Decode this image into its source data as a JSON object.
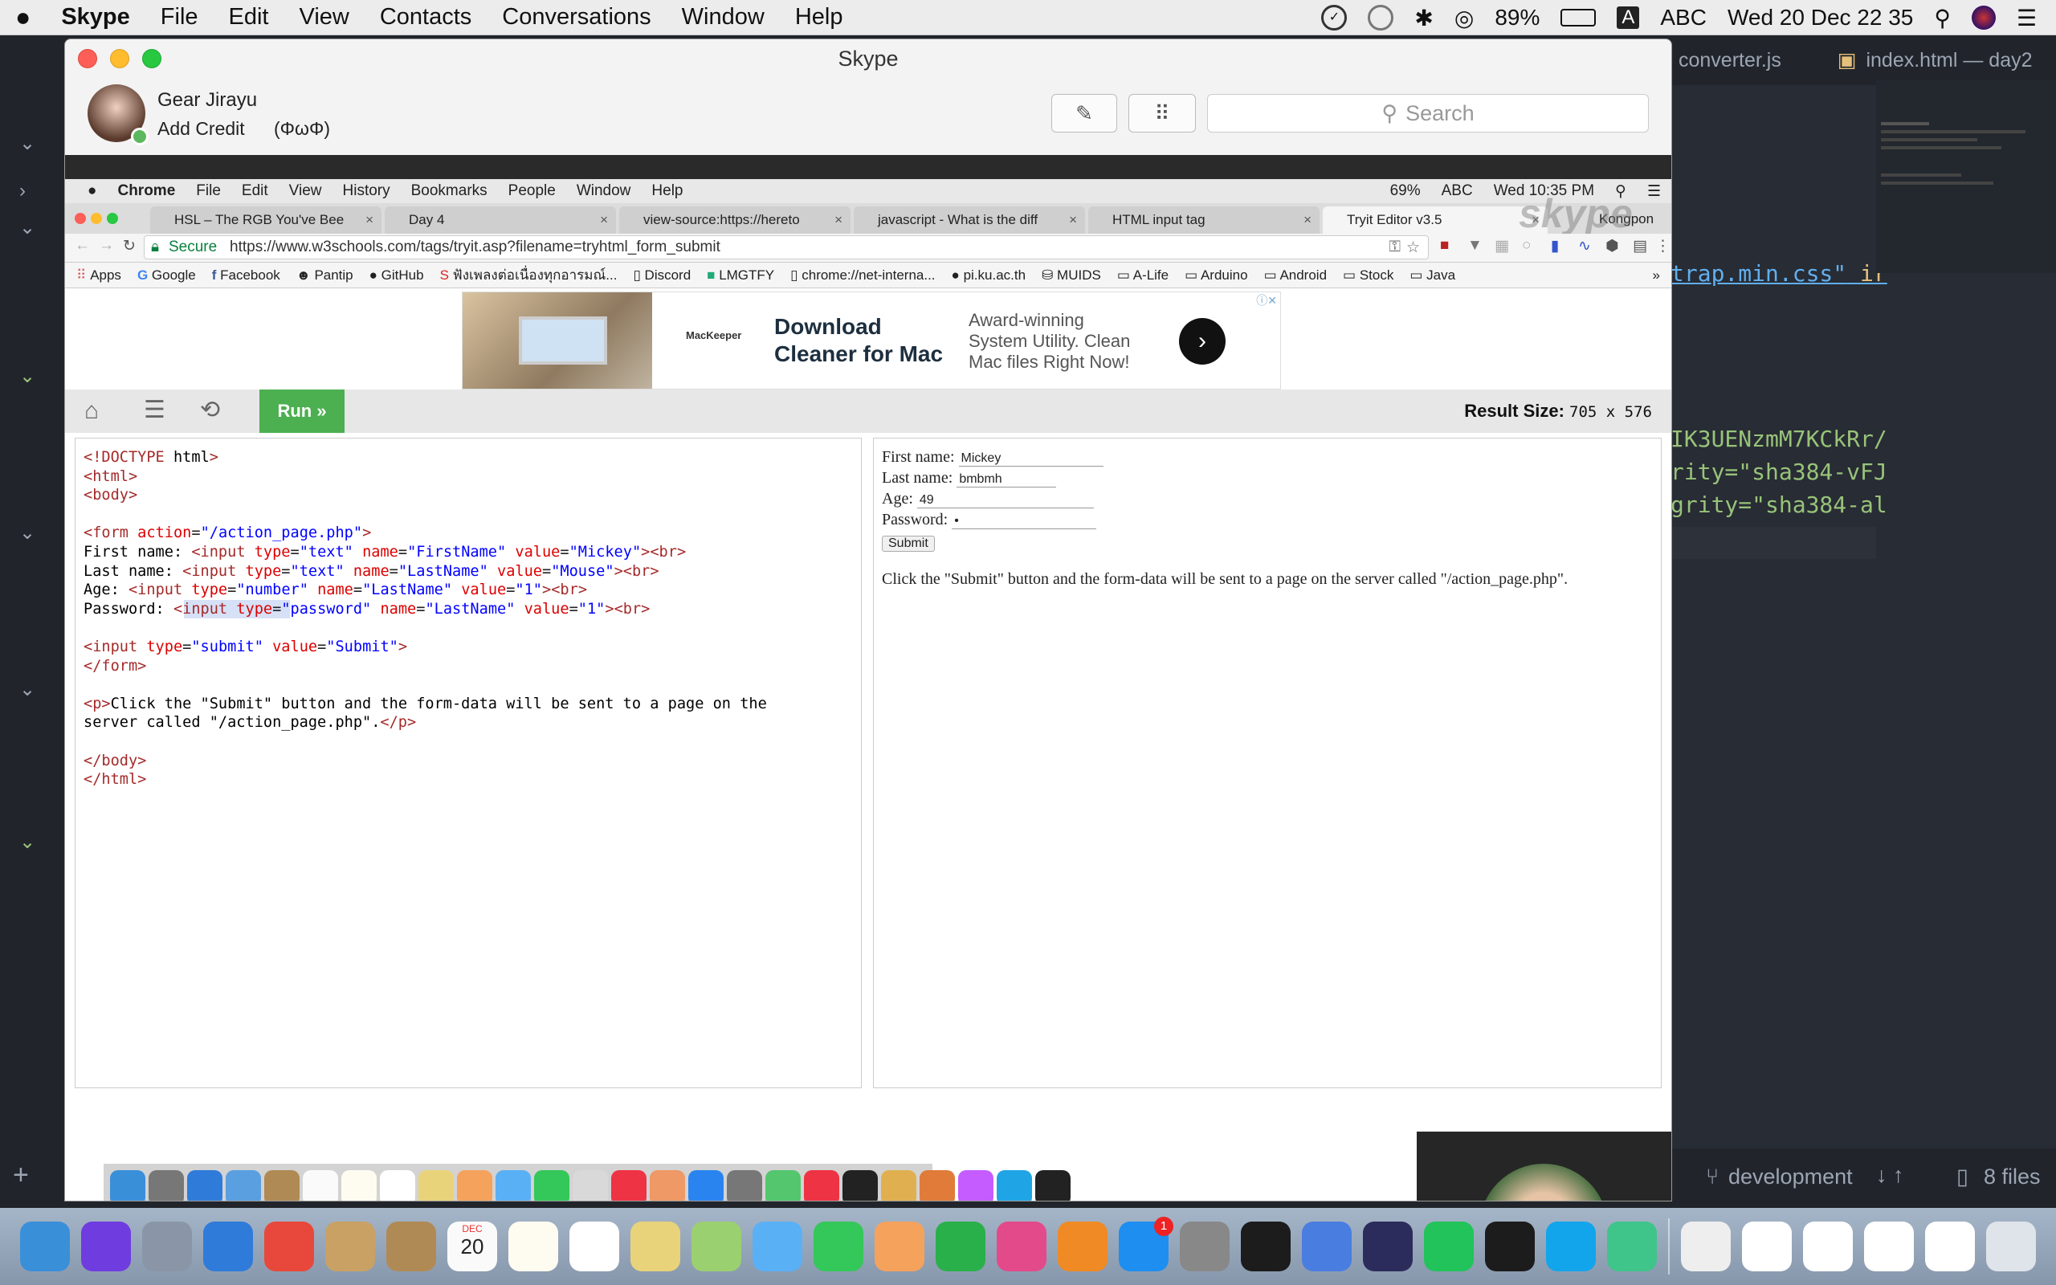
{
  "menubar": {
    "app": "Skype",
    "items": [
      "File",
      "Edit",
      "View",
      "Contacts",
      "Conversations",
      "Window",
      "Help"
    ],
    "battery": "89%",
    "input": "ABC",
    "clock": "Wed 20 Dec  22 35"
  },
  "editor": {
    "tabs": [
      "converter.js",
      "index.html — day2"
    ],
    "lines": [
      {
        "text": "trap.min.css\"",
        "tail": " ir"
      },
      {
        "text": "IK3UENzmM7KCkRr/",
        "tail": ""
      },
      {
        "text": "rity=\"sha384-vFJ",
        "tail": ""
      },
      {
        "text": "grity=\"sha384-al",
        "tail": ""
      }
    ],
    "branch": "development",
    "files": "8 files"
  },
  "skype": {
    "title": "Skype",
    "user_name": "Gear Jirayu",
    "add_credit": "Add Credit",
    "mood": "(ΦωΦ)",
    "search_placeholder": "Search",
    "watermark": "skype",
    "caller": "Kongpon"
  },
  "chrome": {
    "menubar": [
      "Chrome",
      "File",
      "Edit",
      "View",
      "History",
      "Bookmarks",
      "People",
      "Window",
      "Help"
    ],
    "battery": "69%",
    "input": "ABC",
    "clock": "Wed 10:35 PM",
    "tabs": [
      {
        "label": "HSL – The RGB You've Bee"
      },
      {
        "label": "Day 4"
      },
      {
        "label": "view-source:https://hereto"
      },
      {
        "label": "javascript - What is the diff"
      },
      {
        "label": "HTML input tag"
      },
      {
        "label": "Tryit Editor v3.5"
      }
    ],
    "secure": "Secure",
    "url": "https://www.w3schools.com/tags/tryit.asp?filename=tryhtml_form_submit",
    "bookmarks": [
      "Apps",
      "Google",
      "Facebook",
      "Pantip",
      "GitHub",
      "ฟังเพลงต่อเนื่องทุกอารมณ์...",
      "Discord",
      "LMGTFY",
      "chrome://net-interna...",
      "pi.ku.ac.th",
      "MUIDS",
      "A-Life",
      "Arduino",
      "Android",
      "Stock",
      "Java"
    ]
  },
  "ad": {
    "brand": "MacKeeper",
    "headline": "Download Cleaner for Mac",
    "body": "Award-winning System Utility. Clean Mac files Right Now!"
  },
  "tryit": {
    "run_label": "Run »",
    "result_size_label": "Result Size:",
    "result_size_value": "705 x 576",
    "code": [
      "<!DOCTYPE html>",
      "<html>",
      "<body>",
      "",
      "<form action=\"/action_page.php\">",
      "First name: <input type=\"text\" name=\"FirstName\" value=\"Mickey\"><br>",
      "Last name: <input type=\"text\" name=\"LastName\" value=\"Mouse\"><br>",
      "Age: <input type=\"number\" name=\"LastName\" value=\"1\"><br>",
      "Password: <input type=\"password\" name=\"LastName\" value=\"1\"><br>",
      "",
      "<input type=\"submit\" value=\"Submit\">",
      "</form>",
      "",
      "<p>Click the \"Submit\" button and the form-data will be sent to a page on the",
      "server called \"/action_page.php\".</p>",
      "",
      "</body>",
      "</html>"
    ],
    "result": {
      "first_label": "First name:",
      "first_value": "Mickey",
      "last_label": "Last name:",
      "last_value": "bmbmh",
      "age_label": "Age:",
      "age_value": "49",
      "password_label": "Password:",
      "password_value": "•",
      "submit": "Submit",
      "paragraph": "Click the \"Submit\" button and the form-data will be sent to a page on the server called \"/action_page.php\"."
    }
  },
  "dock": {
    "calendar_month": "DEC",
    "calendar_day": "20",
    "badge_mail": "1"
  }
}
